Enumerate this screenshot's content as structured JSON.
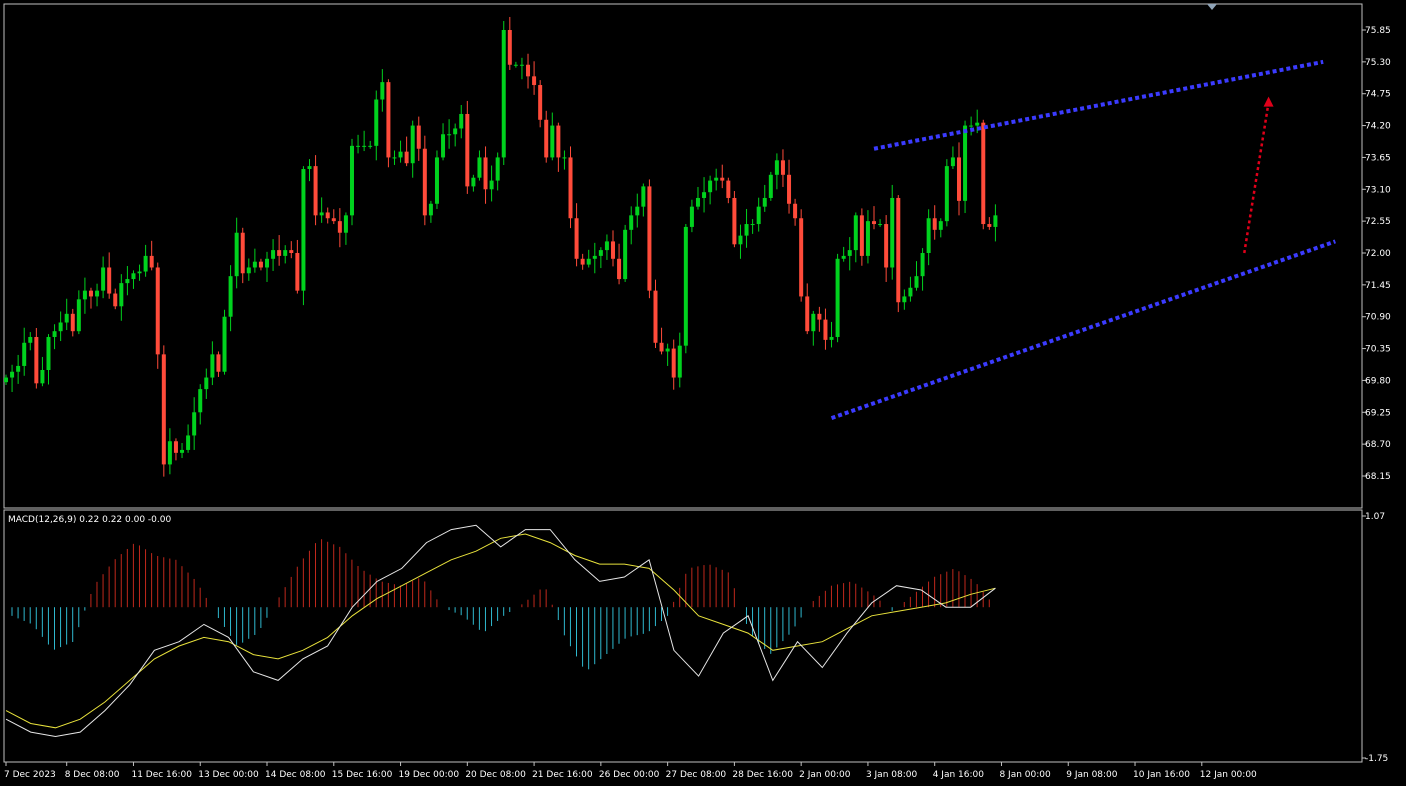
{
  "colors": {
    "background": "#000000",
    "frame": "#c0c0c0",
    "bull": "#00d21e",
    "bear": "#ff4b3a",
    "hist_pos": "#c0281c",
    "hist_neg": "#2fb9cf",
    "macd_line": "#e6e6e6",
    "signal_line": "#e8e23c",
    "channel": "#3b3bff",
    "forecast_arrow": "#e0001a",
    "text": "#ffffff"
  },
  "icons": {
    "shift_marker": "triangle-down-icon"
  },
  "chart_data": [
    {
      "type": "candlestick",
      "title": "",
      "ylim": [
        67.9,
        76.05
      ],
      "y_ticks": [
        "75.85",
        "75.30",
        "74.75",
        "74.20",
        "73.65",
        "73.10",
        "72.55",
        "72.00",
        "71.45",
        "70.90",
        "70.35",
        "69.80",
        "69.25",
        "68.70",
        "68.15"
      ],
      "x_ticks": [
        "7 Dec 2023",
        "8 Dec 08:00",
        "11 Dec 16:00",
        "13 Dec 00:00",
        "14 Dec 08:00",
        "15 Dec 16:00",
        "19 Dec 00:00",
        "20 Dec 08:00",
        "21 Dec 16:00",
        "26 Dec 00:00",
        "27 Dec 08:00",
        "28 Dec 16:00",
        "2 Jan 00:00",
        "3 Jan 08:00",
        "4 Jan 16:00",
        "8 Jan 00:00",
        "9 Jan 08:00",
        "10 Jan 16:00",
        "12 Jan 00:00"
      ],
      "x_tick_bars": [
        0,
        10,
        21,
        32,
        43,
        54,
        65,
        76,
        87,
        98,
        109,
        120,
        131,
        142,
        153,
        164,
        175,
        186,
        197
      ],
      "close_sequence": [
        69.85,
        69.95,
        70.05,
        70.45,
        70.55,
        69.75,
        69.98,
        70.55,
        70.65,
        70.8,
        70.95,
        70.65,
        71.2,
        71.35,
        71.25,
        71.35,
        71.75,
        71.3,
        71.08,
        71.48,
        71.55,
        71.65,
        71.68,
        71.95,
        71.75,
        70.25,
        68.35,
        68.75,
        68.55,
        68.6,
        68.85,
        69.25,
        69.65,
        69.85,
        70.25,
        69.95,
        70.9,
        71.6,
        72.35,
        71.65,
        71.75,
        71.85,
        71.75,
        71.9,
        72.05,
        71.95,
        72.05,
        72.0,
        71.35,
        73.45,
        73.5,
        72.65,
        72.7,
        72.6,
        72.55,
        72.35,
        72.65,
        73.85,
        73.85,
        73.85,
        73.85,
        74.65,
        74.95,
        73.65,
        73.65,
        73.75,
        73.55,
        74.2,
        73.8,
        72.65,
        72.85,
        73.65,
        74.05,
        74.05,
        74.15,
        74.4,
        73.15,
        73.3,
        73.65,
        73.1,
        73.25,
        73.65,
        75.85,
        75.25,
        75.25,
        75.25,
        75.05,
        74.9,
        74.3,
        73.65,
        74.2,
        73.65,
        73.65,
        72.6,
        71.9,
        71.8,
        71.9,
        71.95,
        72.05,
        72.2,
        71.9,
        71.55,
        72.4,
        72.65,
        72.8,
        73.15,
        71.35,
        70.45,
        70.3,
        70.35,
        69.85,
        70.4,
        72.45,
        72.8,
        72.95,
        73.05,
        73.25,
        73.3,
        73.25,
        72.95,
        72.15,
        72.3,
        72.5,
        72.5,
        72.8,
        72.95,
        73.35,
        73.6,
        73.35,
        72.85,
        72.6,
        71.25,
        70.65,
        70.95,
        70.85,
        70.5,
        70.55,
        71.9,
        71.95,
        72.05,
        72.65,
        71.95,
        72.55,
        72.5,
        72.5,
        71.75,
        72.95,
        71.15,
        71.25,
        71.4,
        71.6,
        72.0,
        72.6,
        72.4,
        72.55,
        73.5,
        73.65,
        72.9,
        74.2,
        74.2,
        74.25,
        72.5,
        72.45,
        72.65
      ],
      "channel_upper": {
        "from": {
          "bar": 143,
          "price": 73.8
        },
        "to": {
          "bar": 217,
          "price": 75.3
        }
      },
      "channel_lower": {
        "from": {
          "bar": 136,
          "price": 69.15
        },
        "to": {
          "bar": 219,
          "price": 72.2
        }
      },
      "forecast_arrow": {
        "from": {
          "bar": 204,
          "price": 72.0
        },
        "to": {
          "bar": 208,
          "price": 74.7
        }
      }
    },
    {
      "type": "macd",
      "label": "MACD(12,26,9) 0.22 0.22 0.00 -0.00",
      "ylim": [
        -1.75,
        1.07
      ],
      "y_ticks": [
        "1.07",
        "-1.75"
      ],
      "series": [
        {
          "name": "MACD",
          "values": [
            -1.3,
            -1.45,
            -1.5,
            -1.45,
            -1.2,
            -0.9,
            -0.5,
            -0.4,
            -0.2,
            -0.35,
            -0.75,
            -0.85,
            -0.6,
            -0.45,
            0.0,
            0.3,
            0.45,
            0.75,
            0.9,
            0.95,
            0.7,
            0.9,
            0.9,
            0.55,
            0.3,
            0.35,
            0.55,
            -0.5,
            -0.8,
            -0.3,
            -0.1,
            -0.85,
            -0.4,
            -0.7,
            -0.3,
            0.05,
            0.25,
            0.2,
            0.0,
            0.0,
            0.22
          ]
        },
        {
          "name": "Signal",
          "values": [
            -1.2,
            -1.35,
            -1.4,
            -1.3,
            -1.1,
            -0.85,
            -0.6,
            -0.45,
            -0.35,
            -0.4,
            -0.55,
            -0.6,
            -0.5,
            -0.35,
            -0.1,
            0.1,
            0.25,
            0.4,
            0.55,
            0.65,
            0.8,
            0.85,
            0.75,
            0.6,
            0.5,
            0.5,
            0.45,
            0.2,
            -0.1,
            -0.2,
            -0.3,
            -0.5,
            -0.45,
            -0.4,
            -0.25,
            -0.1,
            -0.05,
            0.0,
            0.05,
            0.15,
            0.22
          ]
        },
        {
          "name": "Histogram",
          "values": [
            -0.1,
            -0.2,
            -0.5,
            -0.4,
            0.25,
            0.55,
            0.75,
            0.6,
            0.55,
            0.3,
            -0.1,
            -0.45,
            -0.3,
            0.1,
            0.5,
            0.8,
            0.7,
            0.45,
            0.3,
            0.25,
            0.35,
            0.0,
            -0.1,
            -0.3,
            -0.1,
            0.05,
            0.25,
            -0.35,
            -0.75,
            -0.55,
            -0.35,
            -0.3,
            -0.1,
            0.45,
            0.5,
            0.4,
            -0.3,
            -0.55,
            -0.3,
            0.05,
            0.25,
            0.3,
            0.15,
            -0.05,
            0.15,
            0.35,
            0.45,
            0.3,
            0.0
          ]
        }
      ]
    }
  ]
}
